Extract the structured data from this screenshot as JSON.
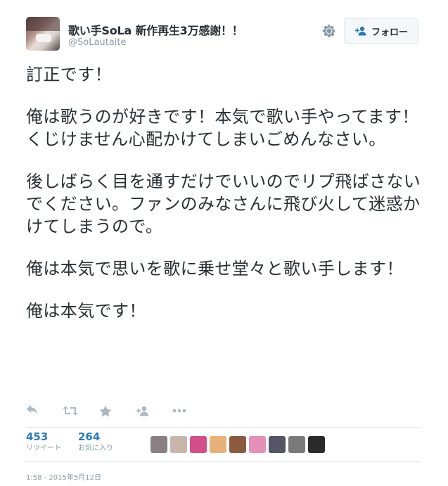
{
  "user": {
    "display_name": "歌い手SoLa 新作再生3万感謝！！",
    "handle": "@SoLautaite"
  },
  "follow_button": {
    "label": "フォロー"
  },
  "tweet": {
    "paragraphs": [
      "訂正です！",
      "俺は歌うのが好きです！本気で歌い手やってます！くじけません心配かけてしまいごめんなさい。",
      "後しばらく目を通すだけでいいのでリプ飛ばさないでください。ファンのみなさんに飛び火して迷惑かけてしまうので。",
      "俺は本気で思いを歌に乗せ堂々と歌い手します！",
      "俺は本気です！"
    ]
  },
  "actions": [
    {
      "icon": "reply-icon"
    },
    {
      "icon": "retweet-icon"
    },
    {
      "icon": "favorite-icon"
    },
    {
      "icon": "follow-user-icon"
    },
    {
      "icon": "more-icon"
    }
  ],
  "stats": {
    "retweets": {
      "count": "453",
      "label": "リツイート"
    },
    "favorites": {
      "count": "264",
      "label": "お気に入り"
    }
  },
  "favoriter_avatars": [
    {
      "color": "#8a7f82"
    },
    {
      "color": "#c8b6ad"
    },
    {
      "color": "#d14f8a"
    },
    {
      "color": "#e8b17a"
    },
    {
      "color": "#8a5b3e"
    },
    {
      "color": "#e58fb6"
    },
    {
      "color": "#555566"
    },
    {
      "color": "#7a7a7a"
    },
    {
      "color": "#2a2a2a"
    }
  ],
  "timestamp": "1:58 - 2015年5月12日",
  "colors": {
    "link": "#2b7bb9",
    "icon_gray": "#aab8c2",
    "text": "#292f33",
    "muted": "#8899a6"
  }
}
